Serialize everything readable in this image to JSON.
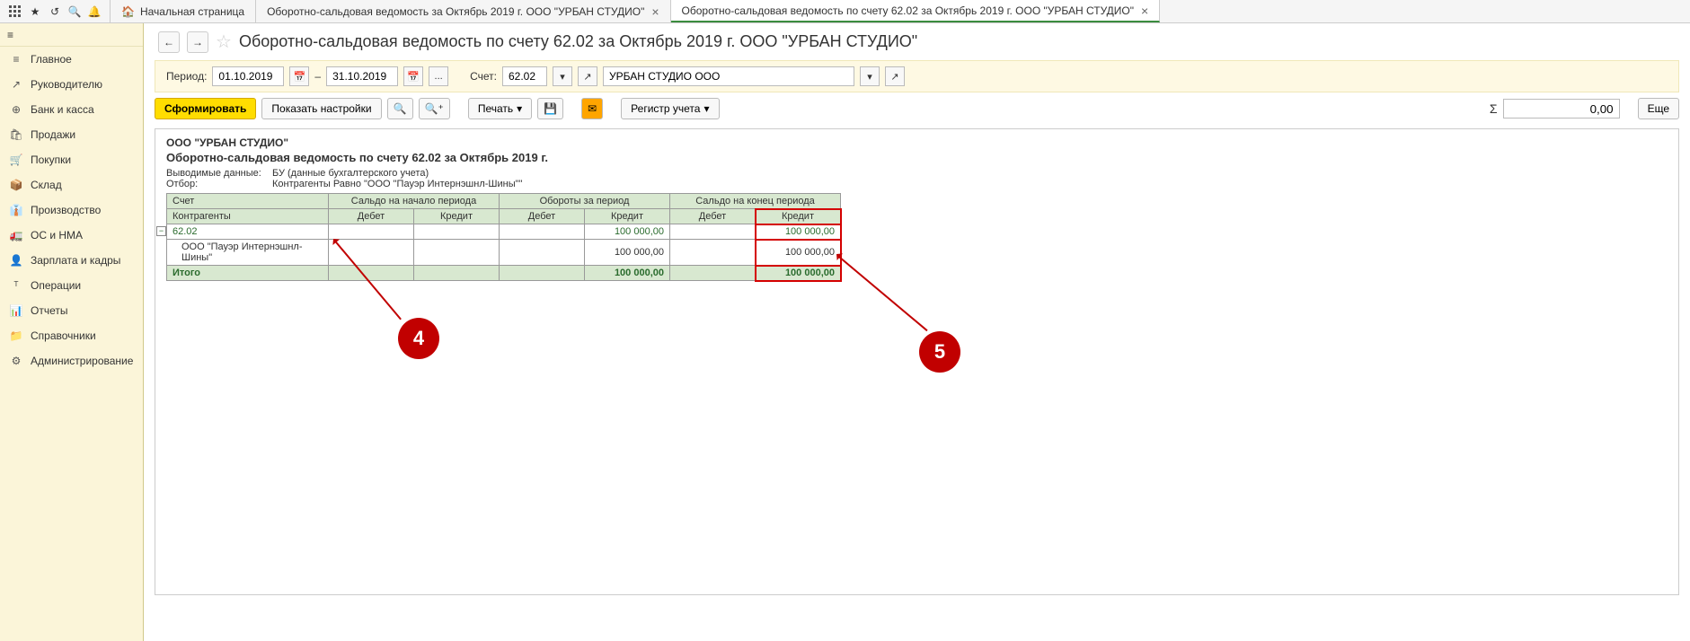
{
  "topbar": {
    "icons": [
      "apps",
      "star",
      "history",
      "search",
      "bell"
    ]
  },
  "tabs": [
    {
      "label": "Начальная страница",
      "hasHome": true,
      "closable": false
    },
    {
      "label": "Оборотно-сальдовая ведомость за Октябрь 2019 г. ООО \"УРБАН СТУДИО\"",
      "closable": true
    },
    {
      "label": "Оборотно-сальдовая ведомость по счету 62.02 за Октябрь 2019 г. ООО \"УРБАН СТУДИО\"",
      "closable": true,
      "active": true
    }
  ],
  "sidebar": {
    "toggle": "≡",
    "items": [
      {
        "icon": "≡",
        "label": "Главное"
      },
      {
        "icon": "↗",
        "label": "Руководителю"
      },
      {
        "icon": "⊕",
        "label": "Банк и касса"
      },
      {
        "icon": "🛍",
        "label": "Продажи"
      },
      {
        "icon": "🛒",
        "label": "Покупки"
      },
      {
        "icon": "📦",
        "label": "Склад"
      },
      {
        "icon": "👔",
        "label": "Производство"
      },
      {
        "icon": "🚛",
        "label": "ОС и НМА"
      },
      {
        "icon": "👤",
        "label": "Зарплата и кадры"
      },
      {
        "icon": "ᵀ",
        "label": "Операции"
      },
      {
        "icon": "📊",
        "label": "Отчеты"
      },
      {
        "icon": "📁",
        "label": "Справочники"
      },
      {
        "icon": "⚙",
        "label": "Администрирование"
      }
    ]
  },
  "header": {
    "back": "←",
    "forward": "→",
    "star": "☆",
    "title": "Оборотно-сальдовая ведомость по счету 62.02 за Октябрь 2019 г. ООО \"УРБАН СТУДИО\""
  },
  "params": {
    "periodLabel": "Период:",
    "dateFrom": "01.10.2019",
    "dash": "–",
    "dateTo": "31.10.2019",
    "ellipsis": "...",
    "accountLabel": "Счет:",
    "account": "62.02",
    "org": "УРБАН СТУДИО ООО"
  },
  "actions": {
    "generate": "Сформировать",
    "settings": "Показать настройки",
    "print": "Печать",
    "registry": "Регистр учета",
    "sumSymbol": "Σ",
    "sumValue": "0,00",
    "more": "Еще"
  },
  "report": {
    "company": "ООО \"УРБАН СТУДИО\"",
    "title": "Оборотно-сальдовая ведомость по счету 62.02 за Октябрь 2019 г.",
    "meta1Label": "Выводимые данные:",
    "meta1Value": "БУ (данные бухгалтерского учета)",
    "meta2Label": "Отбор:",
    "meta2Value": "Контрагенты Равно \"ООО \"Пауэр Интернэшнл-Шины\"\"",
    "headers": {
      "account": "Счет",
      "counterparty": "Контрагенты",
      "startBalance": "Сальдо на начало периода",
      "turnover": "Обороты за период",
      "endBalance": "Сальдо на конец периода",
      "debit": "Дебет",
      "credit": "Кредит"
    },
    "rows": [
      {
        "name": "62.02",
        "cr2": "100 000,00",
        "cr3": "100 000,00"
      },
      {
        "name": "ООО \"Пауэр Интернэшнл-Шины\"",
        "cr2": "100 000,00",
        "cr3": "100 000,00",
        "indent": true
      }
    ],
    "totalLabel": "Итого",
    "total": {
      "cr2": "100 000,00",
      "cr3": "100 000,00"
    }
  },
  "annotations": {
    "a4": "4",
    "a5": "5"
  }
}
